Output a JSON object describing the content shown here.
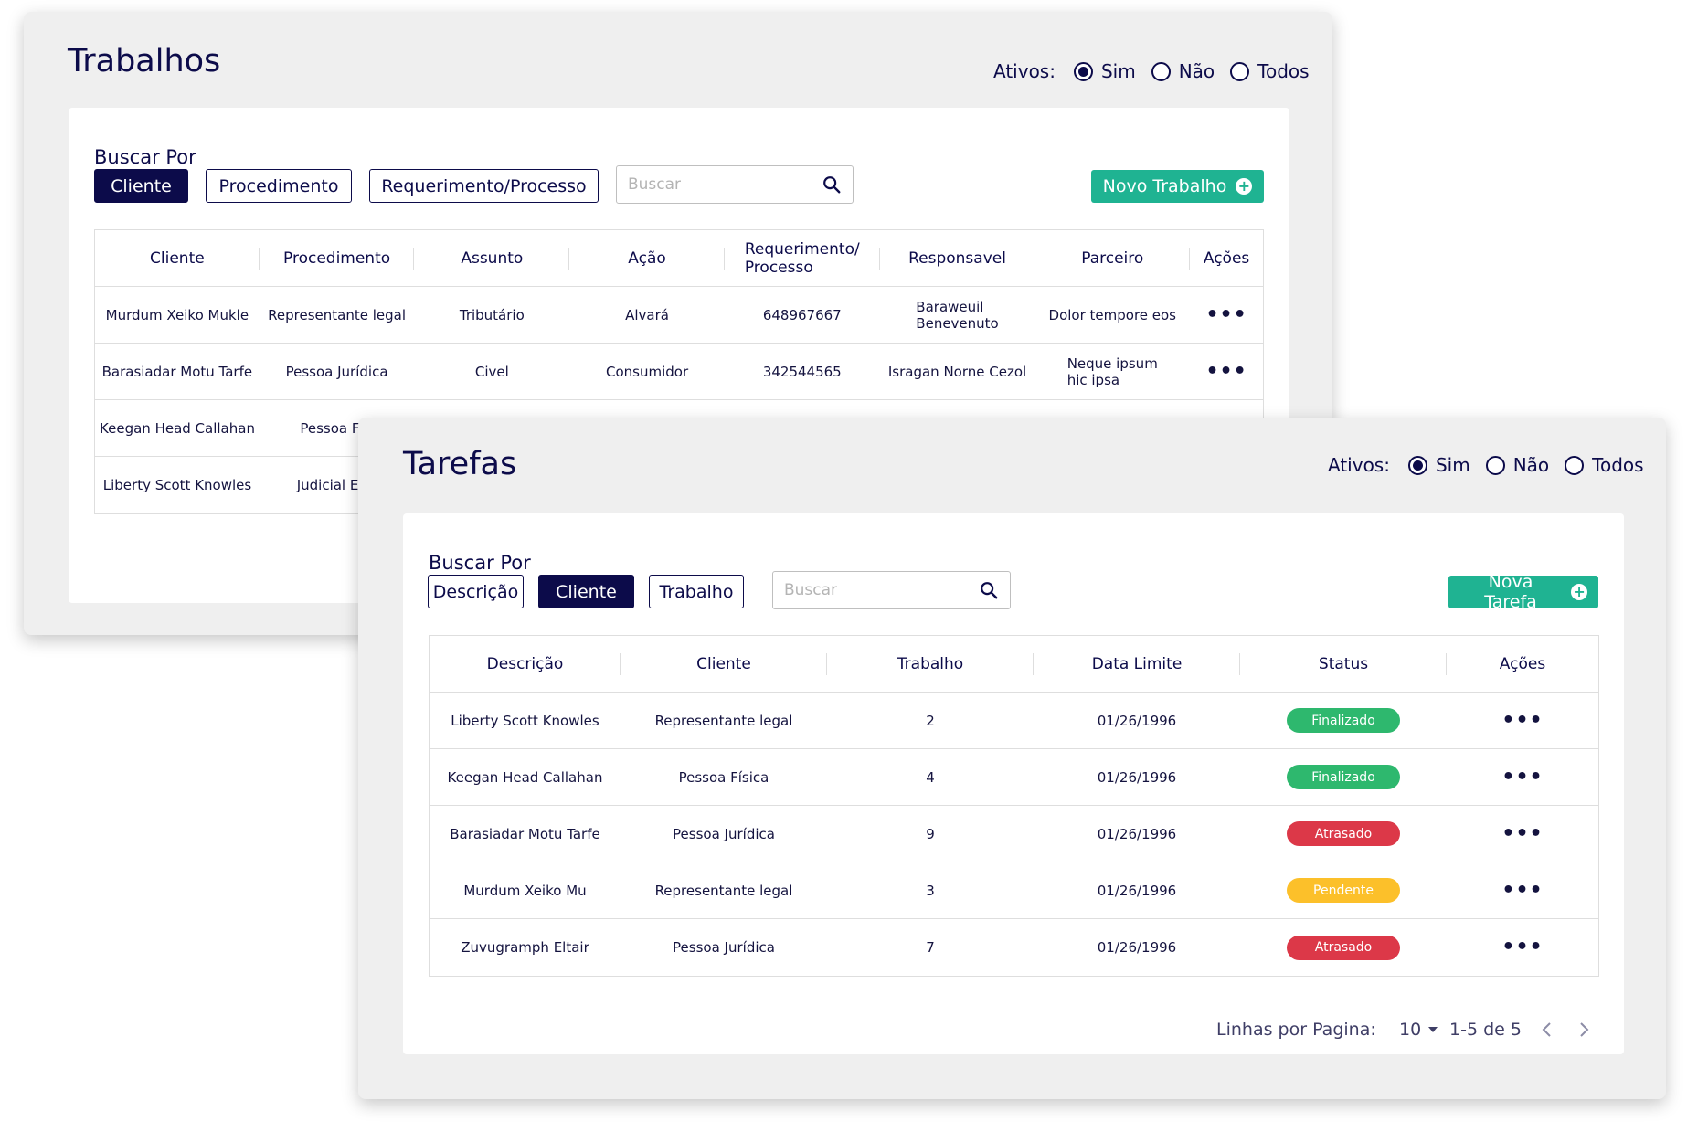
{
  "trabalhos": {
    "title": "Trabalhos",
    "ativos": {
      "label": "Ativos:",
      "options": [
        "Sim",
        "Não",
        "Todos"
      ],
      "selected": "Sim"
    },
    "search_heading": "Buscar Por",
    "filters": [
      "Cliente",
      "Procedimento",
      "Requerimento/Processo"
    ],
    "active_filter": "Cliente",
    "search_placeholder": "Buscar",
    "new_button": "Novo Trabalho",
    "columns": [
      "Cliente",
      "Procedimento",
      "Assunto",
      "Ação",
      "Requerimento/\nProcesso",
      "Responsavel",
      "Parceiro",
      "Ações"
    ],
    "rows": [
      [
        "Murdum Xeiko Mukle",
        "Representante legal",
        "Tributário",
        "Alvará",
        "648967667",
        "Baraweuil\nBenevenuto",
        "Dolor tempore eos"
      ],
      [
        "Barasiadar Motu Tarfe",
        "Pessoa Jurídica",
        "Civel",
        "Consumidor",
        "342544565",
        "Isragan Norne Cezol",
        "Neque ipsum\nhic ipsa"
      ],
      [
        "Keegan Head Callahan",
        "Pessoa Físi",
        "",
        "",
        "",
        "",
        ""
      ],
      [
        "Liberty Scott Knowles",
        "Judicial Extr",
        "",
        "",
        "",
        "",
        ""
      ]
    ]
  },
  "tarefas": {
    "title": "Tarefas",
    "ativos": {
      "label": "Ativos:",
      "options": [
        "Sim",
        "Não",
        "Todos"
      ],
      "selected": "Sim"
    },
    "search_heading": "Buscar Por",
    "filters": [
      "Descrição",
      "Cliente",
      "Trabalho"
    ],
    "active_filter": "Cliente",
    "search_placeholder": "Buscar",
    "new_button": "Nova Tarefa",
    "columns": [
      "Descrição",
      "Cliente",
      "Trabalho",
      "Data Limite",
      "Status",
      "Ações"
    ],
    "rows": [
      {
        "descricao": "Liberty Scott Knowles",
        "cliente": "Representante legal",
        "trabalho": "2",
        "data": "01/26/1996",
        "status": "Finalizado"
      },
      {
        "descricao": "Keegan Head Callahan",
        "cliente": "Pessoa Física",
        "trabalho": "4",
        "data": "01/26/1996",
        "status": "Finalizado"
      },
      {
        "descricao": "Barasiadar Motu Tarfe",
        "cliente": "Pessoa Jurídica",
        "trabalho": "9",
        "data": "01/26/1996",
        "status": "Atrasado"
      },
      {
        "descricao": "Murdum Xeiko Mu",
        "cliente": "Representante legal",
        "trabalho": "3",
        "data": "01/26/1996",
        "status": "Pendente"
      },
      {
        "descricao": "Zuvugramph Eltair",
        "cliente": "Pessoa Jurídica",
        "trabalho": "7",
        "data": "01/26/1996",
        "status": "Atrasado"
      }
    ],
    "pagination": {
      "rows_label": "Linhas por Pagina:",
      "rows_per_page": "10",
      "range": "1-5 de 5"
    }
  },
  "colors": {
    "navy": "#0c0b4a",
    "accent_green": "#1fb392",
    "status_finalizado": "#2eb86e",
    "status_atrasado": "#dc3848",
    "status_pendente": "#fcc02a"
  },
  "icons": {
    "search": "search-icon",
    "add": "plus-circle-icon",
    "actions": "more-horizontal-icon",
    "prev": "chevron-left-icon",
    "next": "chevron-right-icon"
  }
}
